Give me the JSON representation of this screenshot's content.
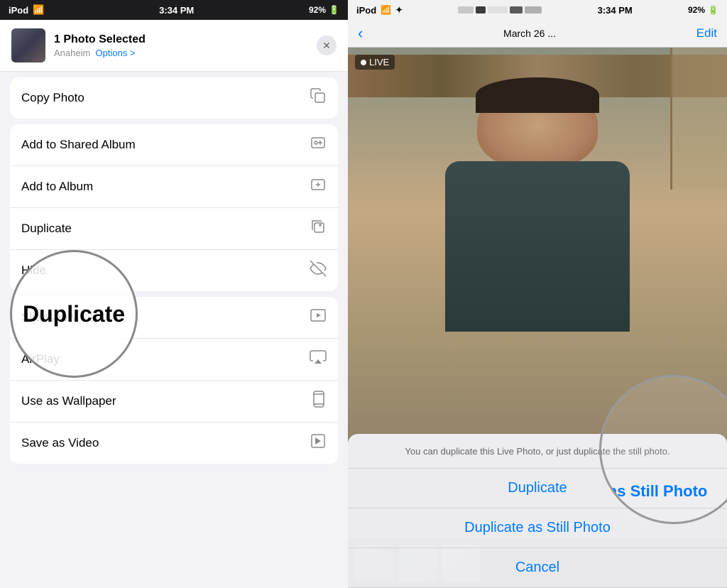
{
  "left": {
    "status_bar": {
      "carrier": "iPod",
      "time": "3:34 PM",
      "battery": "92%"
    },
    "header": {
      "title": "1 Photo Selected",
      "subtitle": "Anaheim",
      "options_label": "Options >",
      "close_label": "✕"
    },
    "menu_items": [
      {
        "label": "Copy Photo",
        "icon": "⧉",
        "id": "copy-photo"
      },
      {
        "label": "Add to Shared Album",
        "icon": "🗃",
        "id": "add-shared"
      },
      {
        "label": "Add to Album",
        "icon": "🗂",
        "id": "add-album"
      },
      {
        "label": "Duplicate",
        "icon": "⧉",
        "id": "duplicate"
      },
      {
        "label": "Hide",
        "icon": "🚫",
        "id": "hide"
      },
      {
        "label": "Slideshow",
        "icon": "▶",
        "id": "slideshow"
      },
      {
        "label": "AirPlay",
        "icon": "⬛",
        "id": "airplay"
      },
      {
        "label": "Use as Wallpaper",
        "icon": "📱",
        "id": "wallpaper"
      },
      {
        "label": "Save as Video",
        "icon": "📋",
        "id": "save-video"
      }
    ],
    "circle_label": "Duplicate"
  },
  "right": {
    "status_bar": {
      "carrier": "iPod",
      "time": "3:34 PM",
      "battery": "92%"
    },
    "nav": {
      "back_label": "‹",
      "date_label": "March 26 ...",
      "edit_label": "Edit"
    },
    "live_badge": "⊙ LIVE",
    "action_sheet": {
      "message": "You can duplicate this Live Photo, or just duplicate the still photo.",
      "items": [
        {
          "label": "Duplicate",
          "id": "dup-live"
        },
        {
          "label": "Duplicate as Still Photo",
          "id": "dup-still"
        },
        {
          "label": "Cancel",
          "id": "cancel"
        }
      ]
    },
    "circle_text": "as Still Photo"
  }
}
